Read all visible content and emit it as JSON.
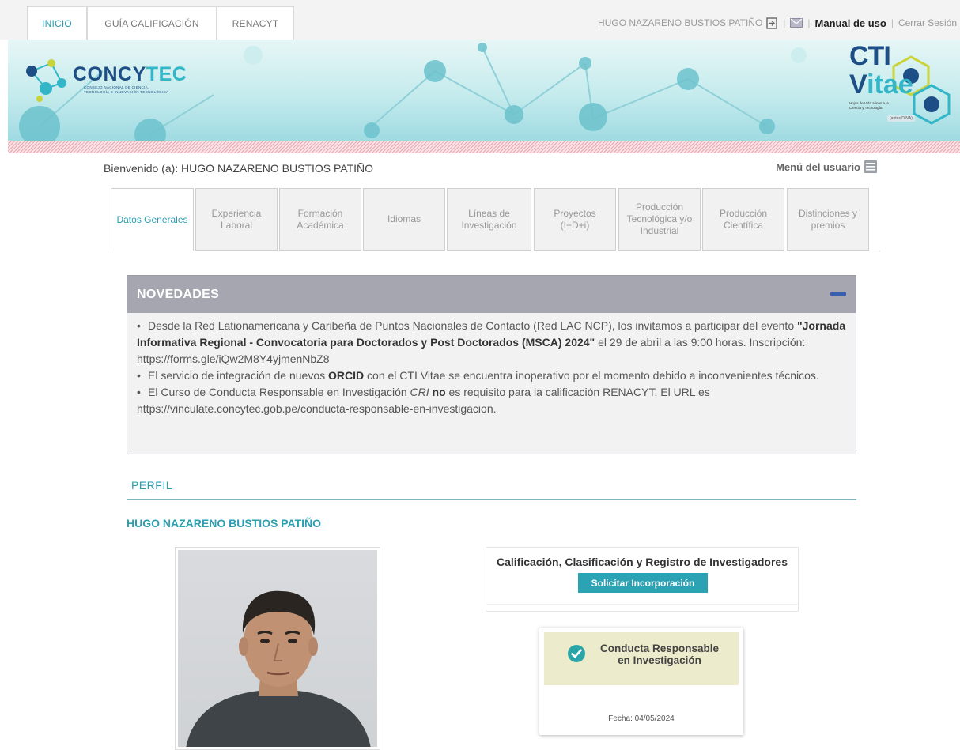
{
  "topnav": {
    "tabs": [
      "INICIO",
      "GUÍA CALIFICACIÓN",
      "RENACYT"
    ],
    "user_name": "HUGO NAZARENO BUSTIOS PATIÑO",
    "manual_label": "Manual de uso",
    "logout_label": "Cerrar Sesión"
  },
  "banner": {
    "org_name_part1": "CONCY",
    "org_name_part2": "TEC",
    "org_subtitle_line1": "CONSEJO NACIONAL DE CIENCIA,",
    "org_subtitle_line2": "TECNOLOGÍA E INNOVACIÓN TECNOLÓGICA",
    "app_name_line1": "CTI",
    "app_name_line2a": "V",
    "app_name_line2b": "itae",
    "app_subtitle": "Hojas de Vida afines a la Ciencia y Tecnología",
    "app_former": "(antes DINA)"
  },
  "welcome": {
    "text": "Bienvenido (a): HUGO NAZARENO BUSTIOS PATIÑO",
    "user_menu": "Menú del usuario"
  },
  "section_tabs": [
    "Datos Generales",
    "Experiencia Laboral",
    "Formación Académica",
    "Idiomas",
    "Líneas de Investigación",
    "Proyectos (I+D+i)",
    "Producción Tecnológica y/o Industrial",
    "Producción Científica",
    "Distinciones y premios"
  ],
  "news": {
    "title": "NOVEDADES",
    "item1_a": "Desde la Red Lationamericana y Caribeña de Puntos Nacionales de Contacto (Red LAC NCP), los invitamos a participar del evento ",
    "item1_b": "\"Jornada Informativa Regional - Convocatoria para Doctorados y Post Doctorados (MSCA) 2024\"",
    "item1_c": " el 29 de abril a las 9:00 horas. Inscripción: https://forms.gle/iQw2M8Y4yjmenNbZ8",
    "item2_a": "El servicio de integración de nuevos ",
    "item2_b": "ORCID",
    "item2_c": " con el CTI Vitae se encuentra inoperativo por el momento debido a inconvenientes técnicos.",
    "item3_a": "El Curso de Conducta Responsable en Investigación ",
    "item3_b": "CRI",
    "item3_c": " no",
    "item3_d": " es requisito para la calificación RENACYT. El URL es https://vinculate.concytec.gob.pe/conducta-responsable-en-investigacion."
  },
  "profile": {
    "section_title": "PERFIL",
    "full_name": "HUGO NAZARENO BUSTIOS PATIÑO"
  },
  "registry": {
    "title": "Calificación, Clasificación y Registro de Investigadores",
    "button": "Solicitar Incorporación"
  },
  "conduct": {
    "line1": "Conducta Responsable",
    "line2": "en Investigación",
    "date": "Fecha: 04/05/2024"
  },
  "colors": {
    "accent": "#2a9fb0",
    "brand_dark": "#1d4f86",
    "news_header": "#a6a6b0",
    "button": "#2ca2b5"
  }
}
